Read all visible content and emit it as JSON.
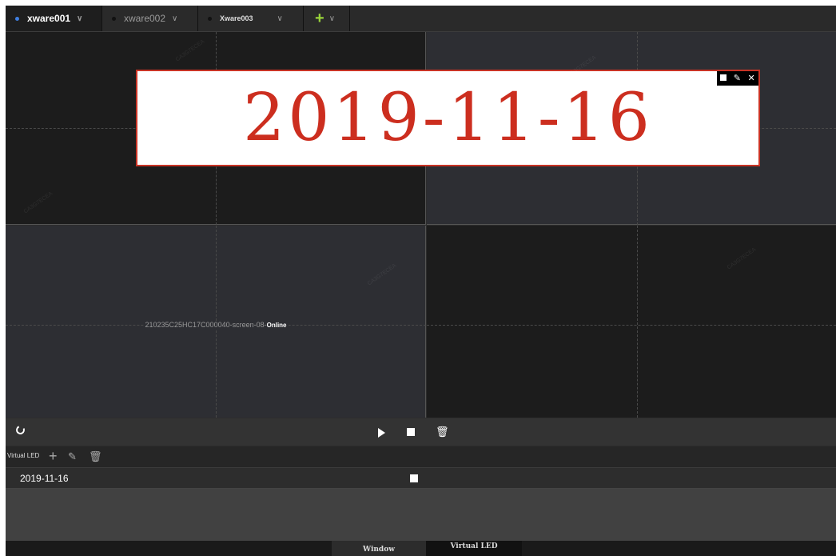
{
  "tabs": [
    {
      "label": "xware001",
      "active": true
    },
    {
      "label": "xware002",
      "active": false
    },
    {
      "label": "Xware003",
      "active": false
    }
  ],
  "add_tab_icon": "plus-icon",
  "screen": {
    "label": "210235C25HC17C000040-screen-08-",
    "status": "Online"
  },
  "led_window": {
    "text": "2019-11-16",
    "text_color": "#cc2e1f",
    "border_color": "#c83325"
  },
  "virtual_led": {
    "title": "Virtual LED",
    "items": [
      {
        "name": "2019-11-16"
      }
    ]
  },
  "bottom_tabs": [
    {
      "label": "Window"
    },
    {
      "label": "Virtual LED"
    }
  ],
  "colors": {
    "accent": "#3f7fe0",
    "add_green": "#9ad53a"
  }
}
